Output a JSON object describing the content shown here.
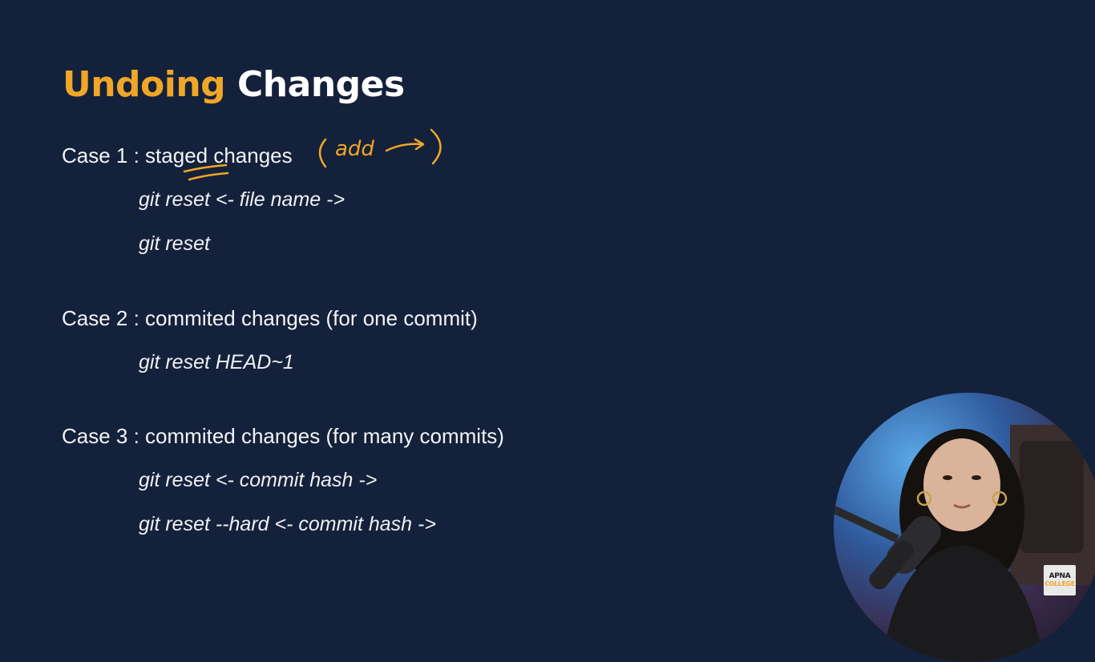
{
  "slide": {
    "title_accent": "Undoing",
    "title_rest": "Changes",
    "annotation_text": "add",
    "cases": [
      {
        "heading": "Case 1 : staged changes",
        "commands": [
          "git reset <- file name ->",
          "git reset"
        ]
      },
      {
        "heading": "Case 2 : commited changes (for one commit)",
        "commands": [
          "git reset HEAD~1"
        ]
      },
      {
        "heading": "Case 3 : commited changes (for many commits)",
        "commands": [
          "git reset <- commit hash ->",
          "git reset --hard <- commit hash ->"
        ]
      }
    ]
  },
  "logo": {
    "line1": "APNA",
    "line2": "COLLEGE"
  },
  "colors": {
    "background": "#14213a",
    "accent": "#f0a628",
    "text": "#f2f4f8"
  }
}
